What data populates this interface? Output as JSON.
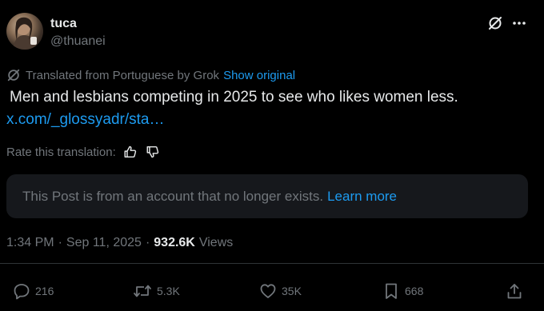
{
  "author": {
    "name": "tuca",
    "handle": "@thuanei"
  },
  "translation": {
    "notice": "Translated from Portuguese by Grok",
    "show_original_label": "Show original"
  },
  "post": {
    "text": " Men and lesbians competing in 2025 to see who likes women less.",
    "link": "x.com/_glossyadr/sta…"
  },
  "rating": {
    "label": "Rate this translation:"
  },
  "quoted_notice": {
    "text": "This Post is from an account that no longer exists.",
    "learn_more_label": "Learn more"
  },
  "meta": {
    "time": "1:34 PM",
    "separator": "·",
    "date": "Sep 11, 2025",
    "views_count": "932.6K",
    "views_label": "Views"
  },
  "actions": {
    "replies": "216",
    "reposts": "5.3K",
    "likes": "35K",
    "bookmarks": "668"
  },
  "icons": {
    "header_grok": "grok-icon",
    "header_more": "more-icon",
    "translate": "grok-icon",
    "thumbs_up": "thumbs-up-icon",
    "thumbs_down": "thumbs-down-icon",
    "reply": "reply-icon",
    "repost": "repost-icon",
    "like": "heart-icon",
    "bookmark": "bookmark-icon",
    "share": "share-icon"
  },
  "colors": {
    "background": "#000000",
    "text_primary": "#e7e9ea",
    "text_secondary": "#71767b",
    "accent": "#1d9bf0",
    "notice_bg": "#16181c",
    "divider": "#2f3336"
  }
}
